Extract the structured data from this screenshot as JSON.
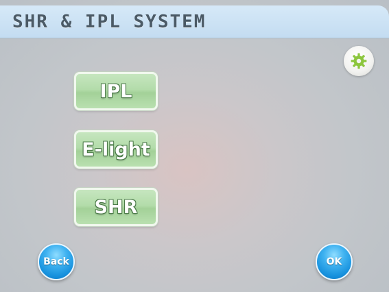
{
  "header": {
    "title": "SHR & IPL SYSTEM"
  },
  "settings": {
    "icon": "gear-icon",
    "icon_color": "#8cc63e"
  },
  "menu": {
    "items": [
      {
        "label": "IPL"
      },
      {
        "label": "E-light"
      },
      {
        "label": "SHR"
      }
    ]
  },
  "footer": {
    "back_label": "Back",
    "ok_label": "OK"
  },
  "colors": {
    "header_bg": "#c9e1f4",
    "menu_button_green": "#b3dcaa",
    "round_button_blue": "#1892de"
  }
}
